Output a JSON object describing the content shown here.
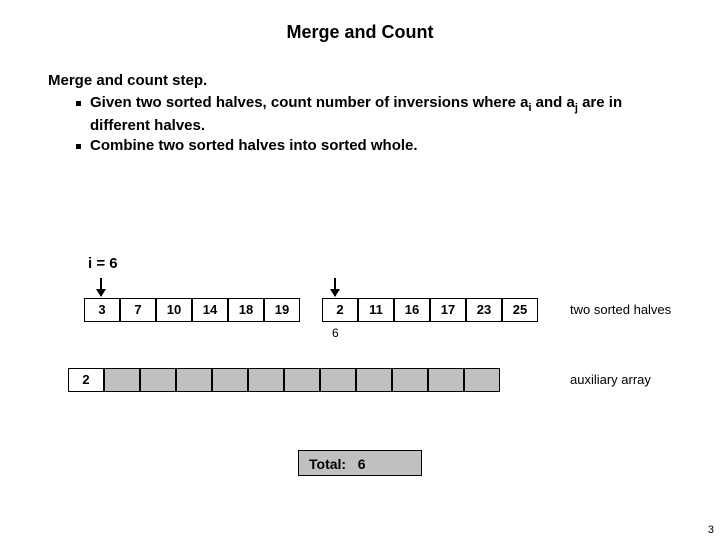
{
  "title": "Merge and Count",
  "body": {
    "heading": "Merge and count step.",
    "bullet1_pre": "Given two sorted halves, count number of inversions where a",
    "bullet1_sub1": "i",
    "bullet1_mid": " and a",
    "bullet1_sub2": "j",
    "bullet1_post": " are in different halves.",
    "bullet2": "Combine two sorted halves into sorted whole."
  },
  "i_label": "i = 6",
  "halves": {
    "left": [
      "3",
      "7",
      "10",
      "14",
      "18",
      "19"
    ],
    "right": [
      "2",
      "11",
      "16",
      "17",
      "23",
      "25"
    ]
  },
  "label_halves": "two sorted halves",
  "six": "6",
  "aux": {
    "first": "2",
    "rest_count": 11
  },
  "label_aux": "auxiliary array",
  "total_label": "Total:",
  "total_value": "6",
  "page": "3"
}
